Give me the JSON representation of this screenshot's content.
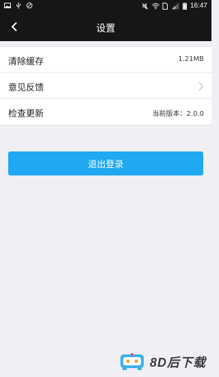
{
  "status_bar": {
    "time": "16:47",
    "left_icons": [
      "image-icon",
      "usb-icon",
      "sync-icon"
    ],
    "right_icons": [
      "mute-icon",
      "wifi-icon",
      "sim-icon",
      "signal-icon",
      "battery-icon"
    ]
  },
  "header": {
    "title": "设置",
    "back_icon": "chevron-left-icon"
  },
  "settings": {
    "clear_cache": {
      "label": "清除缓存",
      "value": "1.21MB"
    },
    "feedback": {
      "label": "意见反馈"
    },
    "check_update": {
      "label": "检查更新",
      "value": "当前版本：2.0.0"
    }
  },
  "logout": {
    "label": "退出登录"
  },
  "watermark": {
    "text": "8D后下载",
    "logo": "robot-logo"
  },
  "colors": {
    "statusbar_bg": "#161616",
    "page_bg": "#f0eff4",
    "accent": "#1fa9f2"
  }
}
